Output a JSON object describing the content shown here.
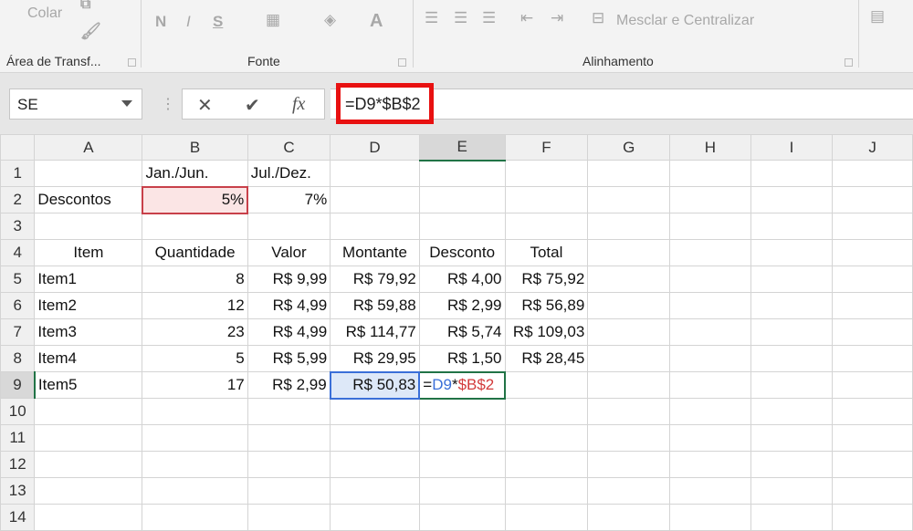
{
  "ribbon": {
    "paste_label": "Colar",
    "groups": [
      "Área de Transf...",
      "Fonte",
      "Alinhamento"
    ],
    "font_buttons": {
      "bold": "N",
      "italic": "I",
      "underline": "S",
      "font_color": "A"
    },
    "merge_label": "Mesclar e Centralizar"
  },
  "formula_bar": {
    "name_box": "SE",
    "cancel": "✕",
    "enter": "✔",
    "fx": "fx",
    "formula": "=D9*$B$2"
  },
  "columns": [
    "A",
    "B",
    "C",
    "D",
    "E",
    "F",
    "G",
    "H",
    "I",
    "J"
  ],
  "rows": [
    {
      "n": "1",
      "cells": [
        "",
        "Jan./Jun.",
        "Jul./Dez.",
        "",
        "",
        "",
        "",
        "",
        "",
        ""
      ]
    },
    {
      "n": "2",
      "cells": [
        "Descontos",
        "5%",
        "7%",
        "",
        "",
        "",
        "",
        "",
        "",
        ""
      ]
    },
    {
      "n": "3",
      "cells": [
        "",
        "",
        "",
        "",
        "",
        "",
        "",
        "",
        "",
        ""
      ]
    },
    {
      "n": "4",
      "cells": [
        "Item",
        "Quantidade",
        "Valor",
        "Montante",
        "Desconto",
        "Total",
        "",
        "",
        "",
        ""
      ]
    },
    {
      "n": "5",
      "cells": [
        "Item1",
        "8",
        "R$ 9,99",
        "R$ 79,92",
        "R$ 4,00",
        "R$ 75,92",
        "",
        "",
        "",
        ""
      ]
    },
    {
      "n": "6",
      "cells": [
        "Item2",
        "12",
        "R$ 4,99",
        "R$ 59,88",
        "R$ 2,99",
        "R$ 56,89",
        "",
        "",
        "",
        ""
      ]
    },
    {
      "n": "7",
      "cells": [
        "Item3",
        "23",
        "R$ 4,99",
        "R$ 114,77",
        "R$ 5,74",
        "R$ 109,03",
        "",
        "",
        "",
        ""
      ]
    },
    {
      "n": "8",
      "cells": [
        "Item4",
        "5",
        "R$ 5,99",
        "R$ 29,95",
        "R$ 1,50",
        "R$ 28,45",
        "",
        "",
        "",
        ""
      ]
    },
    {
      "n": "9",
      "cells": [
        "Item5",
        "17",
        "R$ 2,99",
        "R$ 50,83",
        "",
        "",
        "",
        "",
        "",
        ""
      ]
    },
    {
      "n": "10",
      "cells": [
        "",
        "",
        "",
        "",
        "",
        "",
        "",
        "",
        "",
        ""
      ]
    },
    {
      "n": "11",
      "cells": [
        "",
        "",
        "",
        "",
        "",
        "",
        "",
        "",
        "",
        ""
      ]
    },
    {
      "n": "12",
      "cells": [
        "",
        "",
        "",
        "",
        "",
        "",
        "",
        "",
        "",
        ""
      ]
    },
    {
      "n": "13",
      "cells": [
        "",
        "",
        "",
        "",
        "",
        "",
        "",
        "",
        "",
        ""
      ]
    },
    {
      "n": "14",
      "cells": [
        "",
        "",
        "",
        "",
        "",
        "",
        "",
        "",
        "",
        ""
      ]
    }
  ],
  "edit_cell": {
    "eq": "=",
    "ref1": "D9",
    "op": "*",
    "ref2": "$B$2"
  },
  "colors": {
    "ref1": "#3a6fd8",
    "ref2": "#d23a3a",
    "selection": "#217346"
  }
}
